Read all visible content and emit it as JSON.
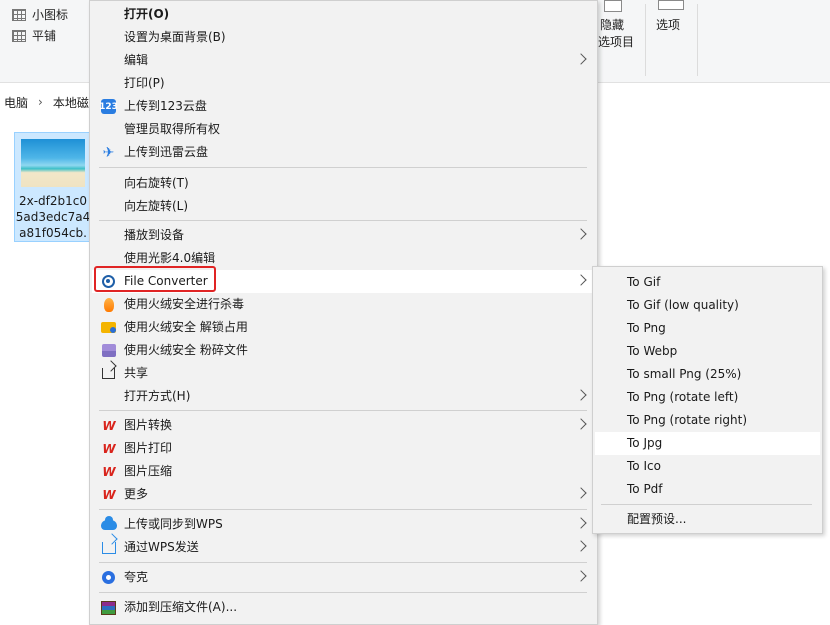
{
  "ribbon": {
    "small_icons": "小图标",
    "tiles": "平铺",
    "hide_selected_line1": "隐藏",
    "hide_selected_line2": "选项目",
    "options": "选项"
  },
  "address": {
    "crumbs": [
      "电脑",
      "本地磁盘"
    ]
  },
  "file": {
    "name_line1": "2x-df2b1c0",
    "name_line2": "5ad3edc7a4",
    "name_line3": "a81f054cb."
  },
  "menu": {
    "items": [
      {
        "label": "打开(O)",
        "icon": "none"
      },
      {
        "label": "设置为桌面背景(B)",
        "icon": "none"
      },
      {
        "label": "编辑",
        "icon": "none"
      },
      {
        "label": "打印(P)",
        "icon": "none"
      },
      {
        "label": "上传到123云盘",
        "icon": "123-cloud-icon",
        "icon_text": "123"
      },
      {
        "label": "管理员取得所有权",
        "icon": "none"
      },
      {
        "label": "上传到迅雷云盘",
        "icon": "thunder-bird-icon"
      },
      {
        "label": "向右旋转(T)",
        "icon": "none"
      },
      {
        "label": "向左旋转(L)",
        "icon": "none"
      },
      {
        "label": "播放到设备",
        "icon": "none"
      },
      {
        "label": "使用光影4.0编辑",
        "icon": "none"
      },
      {
        "label": "File Converter",
        "icon": "file-converter-icon"
      },
      {
        "label": "使用火绒安全进行杀毒",
        "icon": "huorong-fire-icon"
      },
      {
        "label": "使用火绒安全 解锁占用",
        "icon": "huorong-unlock-icon"
      },
      {
        "label": "使用火绒安全 粉碎文件",
        "icon": "huorong-shred-icon"
      },
      {
        "label": "共享",
        "icon": "share-icon"
      },
      {
        "label": "打开方式(H)",
        "icon": "none"
      },
      {
        "label": "图片转换",
        "icon": "wps-icon",
        "icon_text": "W"
      },
      {
        "label": "图片打印",
        "icon": "wps-icon",
        "icon_text": "W"
      },
      {
        "label": "图片压缩",
        "icon": "wps-icon",
        "icon_text": "W"
      },
      {
        "label": "更多",
        "icon": "wps-icon",
        "icon_text": "W"
      },
      {
        "label": "上传或同步到WPS",
        "icon": "wps-cloud-icon"
      },
      {
        "label": "通过WPS发送",
        "icon": "wps-send-icon"
      },
      {
        "label": "夸克",
        "icon": "quark-icon"
      },
      {
        "label": "添加到压缩文件(A)...",
        "icon": "winrar-icon"
      }
    ]
  },
  "submenu": {
    "items": [
      "To Gif",
      "To Gif (low quality)",
      "To Png",
      "To Webp",
      "To small Png (25%)",
      "To Png (rotate left)",
      "To Png (rotate right)",
      "To Jpg",
      "To Ico",
      "To Pdf",
      "配置预设..."
    ]
  },
  "colors": {
    "menu_bg": "#f2f2f2",
    "highlight_bg": "#ffffff",
    "highlight_box": "#e02424",
    "wps_red": "#d9241c",
    "selection_blue": "#cce8ff"
  }
}
